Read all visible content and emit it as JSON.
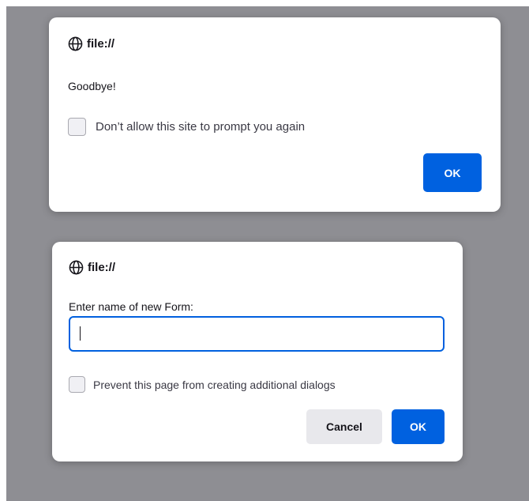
{
  "alert_dialog": {
    "origin": "file://",
    "message": "Goodbye!",
    "checkbox_label": "Don’t allow this site to prompt you again",
    "checkbox_checked": false,
    "ok_label": "OK"
  },
  "prompt_dialog": {
    "origin": "file://",
    "message": "Enter name of new Form:",
    "input_value": "",
    "checkbox_label": "Prevent this page from creating additional dialogs",
    "checkbox_checked": false,
    "cancel_label": "Cancel",
    "ok_label": "OK"
  },
  "icons": {
    "origin_icon": "globe-icon"
  },
  "colors": {
    "backdrop": "#8e8e93",
    "primary_button": "#0061e0",
    "secondary_button": "#e8e8ec",
    "input_focus_border": "#0060df"
  }
}
